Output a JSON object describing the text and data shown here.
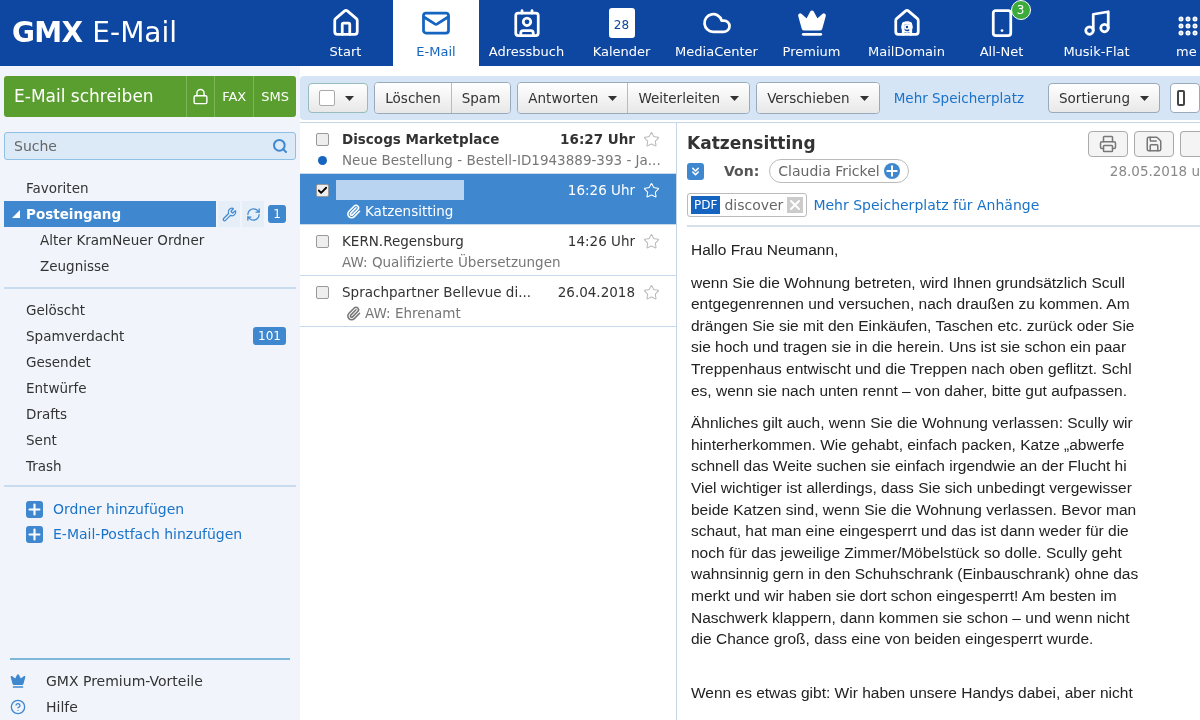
{
  "header": {
    "logo": "GMX",
    "product": "E-Mail",
    "nav": [
      {
        "kind": "home",
        "label": "Start",
        "selected": false
      },
      {
        "kind": "mail",
        "label": "E-Mail",
        "selected": true
      },
      {
        "kind": "contacts",
        "label": "Adressbuch",
        "selected": false
      },
      {
        "kind": "calendar",
        "label": "Kalender",
        "selected": false,
        "day": "28"
      },
      {
        "kind": "cloud",
        "label": "MediaCenter",
        "selected": false
      },
      {
        "kind": "crown",
        "label": "Premium",
        "selected": false
      },
      {
        "kind": "domain",
        "label": "MailDomain",
        "selected": false
      },
      {
        "kind": "sim",
        "label": "All-Net",
        "selected": false,
        "badge": "3"
      },
      {
        "kind": "music",
        "label": "Musik-Flat",
        "selected": false
      },
      {
        "kind": "more",
        "label": "me",
        "selected": false
      }
    ]
  },
  "sidebar": {
    "compose": {
      "label": "E-Mail schreiben",
      "extras": [
        "FAX",
        "SMS"
      ]
    },
    "search": {
      "placeholder": "Suche"
    },
    "folder_groups": [
      [
        {
          "label": "Favoriten",
          "selected": false
        },
        {
          "label": "Posteingang",
          "selected": true,
          "expanded": true,
          "count": "1",
          "children": [
            {
              "label": "Alter KramNeuer Ordner",
              "selected": false
            },
            {
              "label": "Zeugnisse",
              "selected": false
            }
          ]
        }
      ],
      [
        {
          "label": "Gelöscht",
          "selected": false
        },
        {
          "label": "Spamverdacht",
          "selected": false,
          "count": "101"
        },
        {
          "label": "Gesendet",
          "selected": false
        },
        {
          "label": "Entwürfe",
          "selected": false
        },
        {
          "label": "Drafts",
          "selected": false
        },
        {
          "label": "Sent",
          "selected": false
        },
        {
          "label": "Trash",
          "selected": false
        }
      ]
    ],
    "actions": [
      "Ordner hinzufügen",
      "E-Mail-Postfach hinzufügen"
    ],
    "footer": [
      {
        "kind": "crown",
        "label": "GMX Premium-Vorteile"
      },
      {
        "kind": "help",
        "label": "Hilfe"
      }
    ]
  },
  "toolbar": {
    "select_all": {
      "checked": false
    },
    "groups": [
      [
        {
          "label": "Löschen",
          "menu": false
        },
        {
          "label": "Spam",
          "menu": false
        }
      ],
      [
        {
          "label": "Antworten",
          "menu": true
        },
        {
          "label": "Weiterleiten",
          "menu": true
        }
      ],
      [
        {
          "label": "Verschieben",
          "menu": true
        }
      ]
    ],
    "link": "Mehr Speicherplatz",
    "sort": "Sortierung"
  },
  "messages": [
    {
      "sender": "Discogs Marketplace",
      "time": "16:27 Uhr",
      "subject": "Neue Bestellung - Bestell-ID1943889-393 - Ja...",
      "unread": true,
      "checked": false,
      "selected": false,
      "attachment": false,
      "starred": false
    },
    {
      "redacted": true,
      "time": "16:26 Uhr",
      "subject": "Katzensitting",
      "unread": false,
      "checked": true,
      "selected": true,
      "attachment": true,
      "starred": false
    },
    {
      "sender": "KERN.Regensburg",
      "time": "14:26 Uhr",
      "subject": "AW: Qualifizierte Übersetzungen",
      "unread": false,
      "checked": false,
      "selected": false,
      "attachment": false,
      "starred": false
    },
    {
      "sender": "Sprachpartner Bellevue di...",
      "time": "26.04.2018",
      "subject": "AW: Ehrenamt",
      "unread": false,
      "checked": false,
      "selected": false,
      "attachment": true,
      "starred": false
    }
  ],
  "reader": {
    "subject": "Katzensitting",
    "from_label": "Von:",
    "from": "Claudia Frickel",
    "date": "28.05.2018 u",
    "attachment": {
      "type": "PDF",
      "name": "discover"
    },
    "attachment_link": "Mehr Speicherplatz für Anhänge",
    "body": [
      [
        "Hallo Frau Neumann,"
      ],
      [
        "wenn Sie die Wohnung betreten, wird Ihnen grundsätzlich Scull",
        "entgegenrennen und versuchen, nach draußen zu kommen. Am",
        "drängen Sie sie mit den Einkäufen, Taschen etc. zurück oder Sie",
        "sie hoch und tragen sie in die herein. Uns ist sie schon ein paar",
        "Treppenhaus entwischt und die Treppen nach oben geflitzt. Schl",
        "es, wenn sie nach unten rennt – von daher, bitte gut aufpassen."
      ],
      [
        "Ähnliches gilt auch, wenn Sie die Wohnung verlassen: Scully wir",
        "hinterherkommen. Wie gehabt, einfach packen, Katze „abwerfe",
        "schnell das Weite suchen sie einfach irgendwie an der Flucht hi",
        "Viel wichtiger ist allerdings, dass Sie sich unbedingt vergewisser",
        "beide Katzen sind, wenn Sie die Wohnung verlassen. Bevor man",
        "schaut, hat man eine eingesperrt und das ist dann weder für die",
        "noch für das jeweilige Zimmer/Möbelstück so dolle. Scully geht",
        "wahnsinnig gern in den Schuhschrank (Einbauschrank) ohne das",
        "merkt und wir haben sie dort schon eingesperrt! Am besten im",
        "Naschwerk klappern, dann kommen sie schon – und wenn nicht",
        "die Chance groß, dass eine von beiden eingesperrt wurde."
      ],
      [
        "Wenn es etwas gibt: Wir haben unsere Handys dabei, aber nicht"
      ]
    ]
  }
}
